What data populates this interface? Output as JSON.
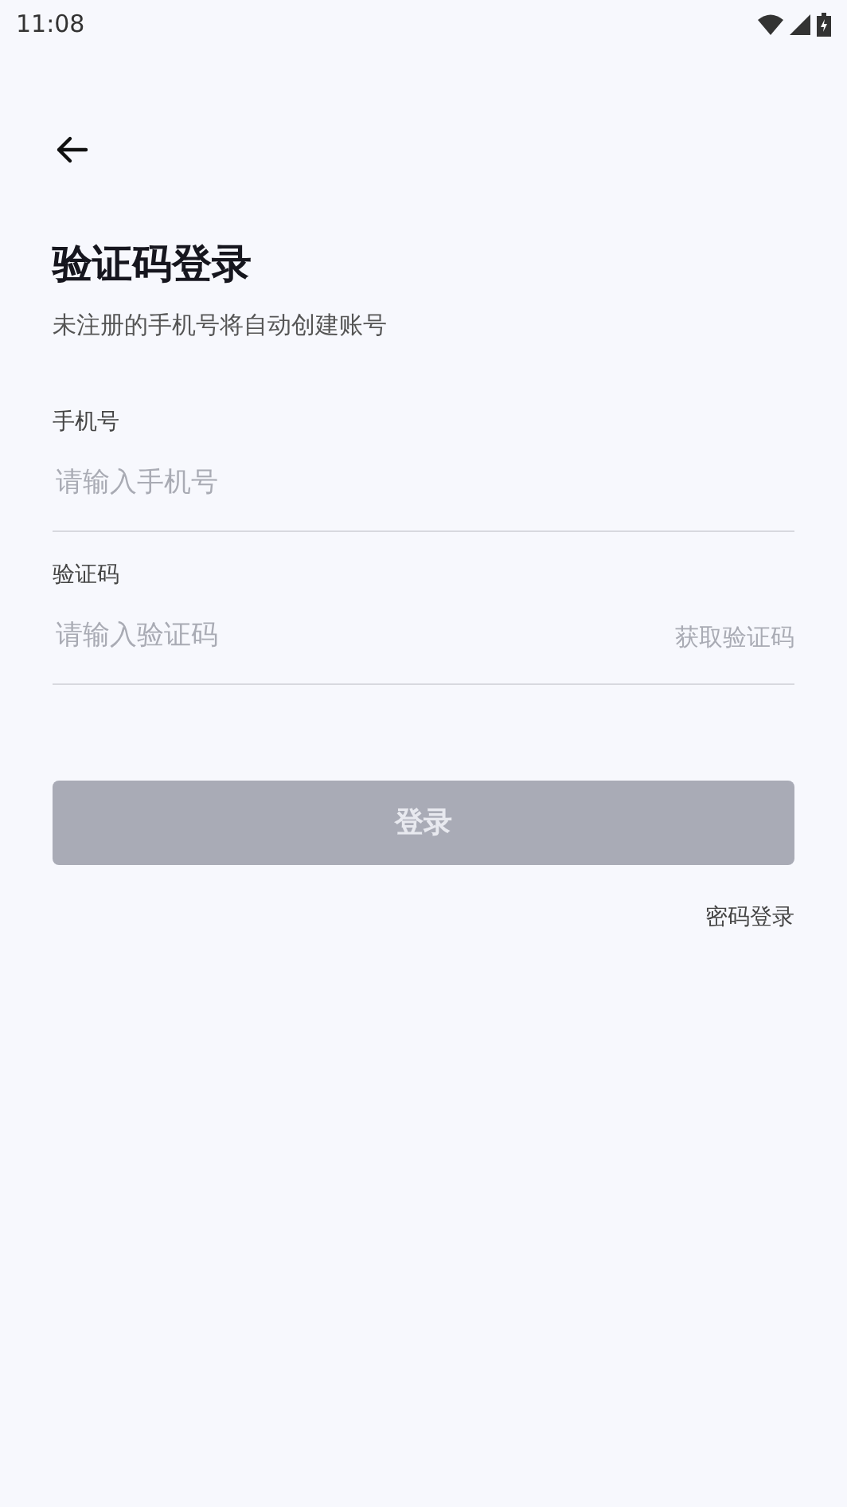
{
  "status_bar": {
    "time": "11:08"
  },
  "title": "验证码登录",
  "subtitle": "未注册的手机号将自动创建账号",
  "fields": [
    {
      "label": "手机号",
      "placeholder": "请输入手机号"
    },
    {
      "label": "验证码",
      "placeholder": "请输入验证码",
      "action": "获取验证码"
    }
  ],
  "login_button": {
    "label": "登录",
    "disabled": true
  },
  "alt_link": "密码登录"
}
